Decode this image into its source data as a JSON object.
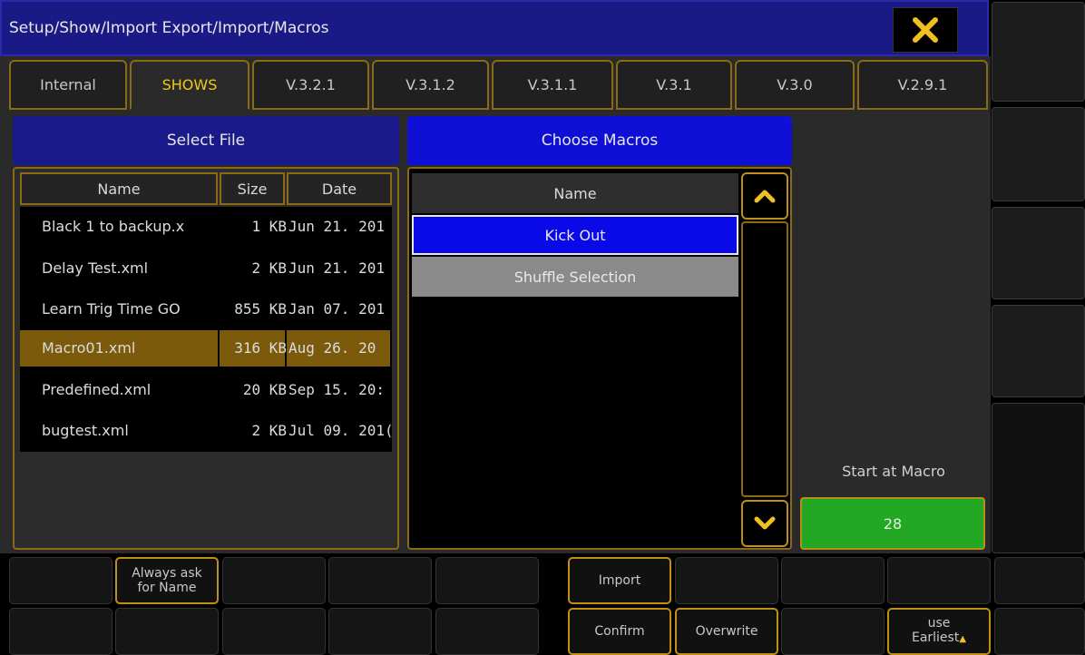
{
  "window": {
    "title": "Setup/Show/Import Export/Import/Macros",
    "close_icon": "close-x-icon",
    "close_color": "#f0c020"
  },
  "tabs": [
    {
      "label": "Internal",
      "active": false
    },
    {
      "label": "SHOWS",
      "active": true
    },
    {
      "label": "V.3.2.1",
      "active": false
    },
    {
      "label": "V.3.1.2",
      "active": false
    },
    {
      "label": "V.3.1.1",
      "active": false
    },
    {
      "label": "V.3.1",
      "active": false
    },
    {
      "label": "V.3.0",
      "active": false
    },
    {
      "label": "V.2.9.1",
      "active": false
    }
  ],
  "file_section": {
    "header": "Select File",
    "columns": {
      "name": "Name",
      "size": "Size",
      "date": "Date"
    },
    "rows": [
      {
        "name": "Black 1 to backup.x",
        "size": "1 KB",
        "date": "Jun 21. 201"
      },
      {
        "name": "Delay Test.xml",
        "size": "2 KB",
        "date": "Jun 21. 201"
      },
      {
        "name": "Learn Trig Time GO",
        "size": "855 KB",
        "date": "Jan 07. 201"
      },
      {
        "name": "Macro01.xml",
        "size": "316 KB",
        "date": "Aug 26. 20",
        "selected": true
      },
      {
        "name": "Predefined.xml",
        "size": "20 KB",
        "date": "Sep 15. 20:"
      },
      {
        "name": "bugtest.xml",
        "size": "2 KB",
        "date": "Jul 09. 201("
      }
    ]
  },
  "macro_section": {
    "header": "Choose Macros",
    "column": "Name",
    "rows": [
      {
        "label": "Kick Out",
        "state": "highlighted"
      },
      {
        "label": "Shuffle Selection",
        "state": "selected"
      }
    ],
    "scroll_up_icon": "chevron-up-icon",
    "scroll_down_icon": "chevron-down-icon"
  },
  "start_at_macro": {
    "label": "Start at Macro",
    "value": "28"
  },
  "bottom_row1": {
    "always_ask_line1": "Always ask",
    "always_ask_line2": "for Name",
    "import": "Import"
  },
  "bottom_row2": {
    "confirm": "Confirm",
    "overwrite": "Overwrite",
    "use_earliest_line1": "use",
    "use_earliest_line2": "Earliest"
  },
  "colors": {
    "accent_gold": "#c09014",
    "title_blue": "#1a1a86",
    "highlight_blue": "#0f0fd6",
    "selection_brown": "#7c5a0c",
    "value_green": "#22a822"
  }
}
